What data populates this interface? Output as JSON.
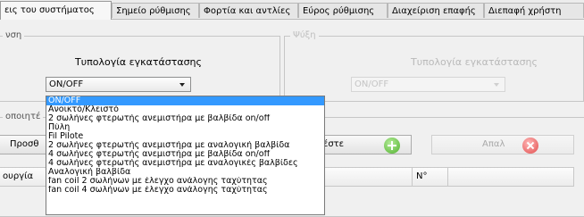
{
  "tabs": [
    {
      "label": "εις του συστήματος",
      "active": true
    },
    {
      "label": "Σημείο ρύθμισης",
      "active": false
    },
    {
      "label": "Φορτία και αντλίες",
      "active": false
    },
    {
      "label": "Εύρος ρύθμισης",
      "active": false
    },
    {
      "label": "Διαχείριση επαφής",
      "active": false
    },
    {
      "label": "Διεπαφή χρήστη",
      "active": false
    }
  ],
  "left_group": {
    "title": "νση",
    "label": "Τυπολογία εγκατάστασης",
    "select_value": "ON/OFF"
  },
  "right_group": {
    "title": "Ψύξη",
    "label": "Τυπολογία εγκατάστασης",
    "select_value": "ON/OFF"
  },
  "lower_group": {
    "title": "οποιητέ"
  },
  "buttons": {
    "add_left": "Προσθ",
    "add_right": "ροσθέστε",
    "delete_right": "Απαλ"
  },
  "grid_left": {
    "col1": "ουργία"
  },
  "grid_right": {
    "col1": "ργία",
    "col2": "N°"
  },
  "dropdown_options": [
    "ON/OFF",
    "Ανοικτό/Κλειστό",
    "2 σωλήνες φτερωτής ανεμιστήρα με βαλβίδα on/off",
    "Πύλη",
    "Fil Pilote",
    "2 σωλήνες φτερωτής ανεμιστήρα με αναλογική βαλβίδα",
    "4 σωλήνες φτερωτής ανεμιστήρα με βαλβίδα on/off",
    "4 σωλήνες φτερωτής ανεμιστήρα με αναλογικές βαλβίδες",
    "Αναλογική βαλβίδα",
    "fan coil 2 σωλήνων με έλεγχο ανάλογης ταχύτητας",
    "fan coil 4 σωλήνων με έλεγχο ανάλογης ταχύτητας"
  ],
  "dropdown_selected_index": 0,
  "colors": {
    "selection": "#3399ff",
    "add_icon": "#4fb02c",
    "delete_icon": "#e14b4b"
  }
}
